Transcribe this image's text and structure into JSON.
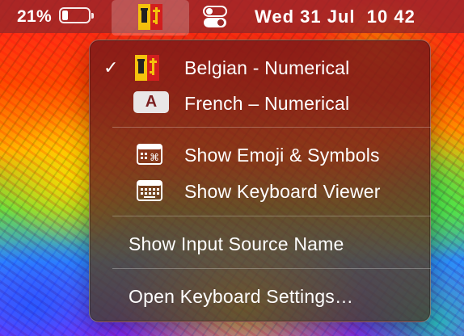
{
  "menubar": {
    "battery_percent": "21%",
    "battery_level": 0.21,
    "clock": "Wed 31 Jul  10 42",
    "input_source_icon": "geneva-flag-icon",
    "control_center_icon": "control-center-icon"
  },
  "input_menu": {
    "sources": [
      {
        "label": "Belgian - Numerical",
        "selected": true,
        "icon": "geneva-flag-icon"
      },
      {
        "label": "French – Numerical",
        "selected": false,
        "icon": "letter-a-badge-icon",
        "badge": "A"
      }
    ],
    "viewers": [
      {
        "label": "Show Emoji & Symbols",
        "icon": "emoji-symbols-icon"
      },
      {
        "label": "Show Keyboard Viewer",
        "icon": "keyboard-viewer-icon"
      }
    ],
    "show_input_source_name": "Show Input Source Name",
    "open_keyboard_settings": "Open Keyboard Settings…",
    "checkmark": "✓"
  },
  "colors": {
    "menubar_bg": "#962828",
    "menu_bg": "#7d1919",
    "flag_red": "#d11f1f",
    "flag_yellow": "#f4c20d"
  }
}
